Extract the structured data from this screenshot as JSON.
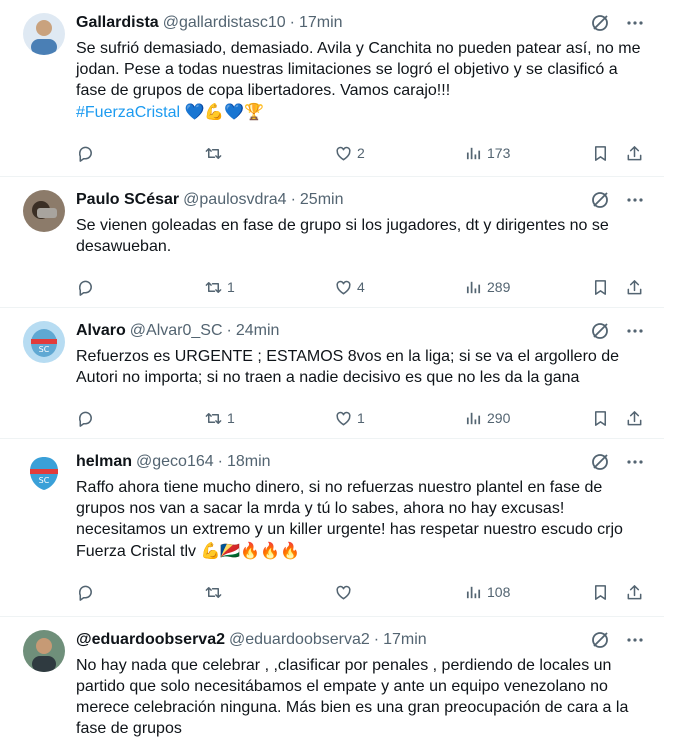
{
  "tweets": [
    {
      "name": "Gallardista",
      "handle": "@gallardistasc10",
      "dot": "·",
      "time": "17min",
      "text": "Se sufrió demasiado, demasiado. Avila y Canchita no pueden patear así, no me jodan. Pese a todas nuestras limitaciones se logró el objetivo y se clasificó a fase de grupos de copa libertadores. Vamos carajo!!!",
      "hashtag": "#FuerzaCristal",
      "emoji": "💙💪💙🏆",
      "replies": "",
      "retweets": "",
      "likes": "2",
      "views": "173",
      "avatar_color": "#4a7fb5"
    },
    {
      "name": "Paulo SCésar",
      "handle": "@paulosvdra4",
      "dot": "·",
      "time": "25min",
      "text": "Se vienen goleadas en fase de grupo si los jugadores, dt y dirigentes no se desawueban.",
      "hashtag": "",
      "emoji": "",
      "replies": "",
      "retweets": "1",
      "likes": "4",
      "views": "289",
      "avatar_color": "#5b4a3a"
    },
    {
      "name": "Alvaro",
      "handle": "@Alvar0_SC",
      "dot": "·",
      "time": "24min",
      "text": "Refuerzos es URGENTE ; ESTAMOS 8vos en la liga; si se va el argollero de Autori no importa; si no traen a  nadie decisivo es que no les da la gana",
      "hashtag": "",
      "emoji": "",
      "replies": "",
      "retweets": "1",
      "likes": "1",
      "views": "290",
      "avatar_color": "#5fa8d3"
    },
    {
      "name": "helman",
      "handle": "@geco164",
      "dot": "·",
      "time": "18min",
      "text": "Raffo ahora tiene mucho dinero, si no refuerzas nuestro plantel en fase de grupos nos van a sacar la mrda y tú lo sabes, ahora no hay excusas! necesitamos un extremo y un killer urgente! has respetar nuestro escudo crjo Fuerza Cristal tlv",
      "hashtag": "",
      "emoji": "💪🇸🇨🔥🔥🔥",
      "replies": "",
      "retweets": "",
      "likes": "",
      "views": "108",
      "avatar_color": "#3aa0d8"
    },
    {
      "name": "@eduardoobserva2",
      "handle": "@eduardoobserva2",
      "dot": "·",
      "time": "17min",
      "text": "No hay nada que celebrar , ,clasificar por penales , perdiendo de locales un partido que solo necesitábamos el empate y ante un equipo venezolano no merece celebración ninguna. Más bien es una gran preocupación de cara a la fase de grupos",
      "hashtag": "",
      "emoji": "",
      "replies": "",
      "retweets": "",
      "likes": "",
      "views": "",
      "avatar_color": "#2f3a40"
    }
  ],
  "icons": {
    "reply": "reply-icon",
    "retweet": "retweet-icon",
    "like": "like-icon",
    "views": "views-icon",
    "bookmark": "bookmark-icon",
    "share": "share-icon",
    "grok": "grok-icon",
    "more": "more-icon"
  },
  "colors": {
    "text": "#0f1419",
    "muted": "#536471",
    "link": "#1d9bf0",
    "divider": "#eff3f4"
  }
}
